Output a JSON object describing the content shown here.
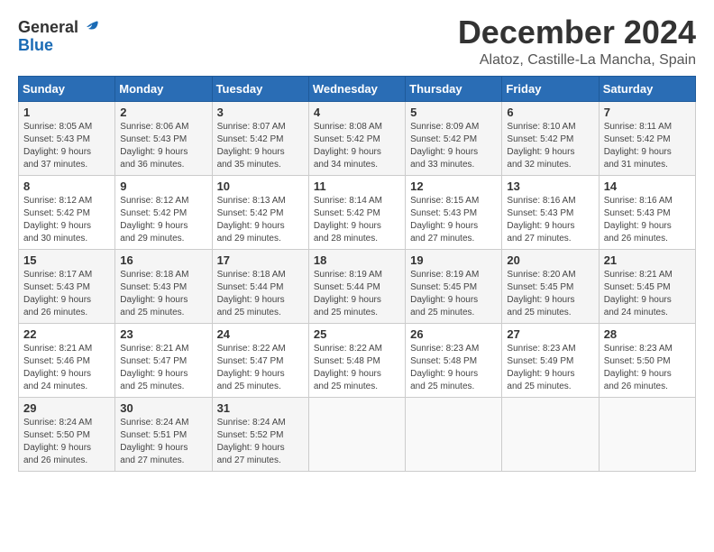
{
  "header": {
    "logo_line1": "General",
    "logo_line2": "Blue",
    "title": "December 2024",
    "location": "Alatoz, Castille-La Mancha, Spain"
  },
  "calendar": {
    "headers": [
      "Sunday",
      "Monday",
      "Tuesday",
      "Wednesday",
      "Thursday",
      "Friday",
      "Saturday"
    ],
    "weeks": [
      [
        {
          "day": "1",
          "detail": "Sunrise: 8:05 AM\nSunset: 5:43 PM\nDaylight: 9 hours\nand 37 minutes."
        },
        {
          "day": "2",
          "detail": "Sunrise: 8:06 AM\nSunset: 5:43 PM\nDaylight: 9 hours\nand 36 minutes."
        },
        {
          "day": "3",
          "detail": "Sunrise: 8:07 AM\nSunset: 5:42 PM\nDaylight: 9 hours\nand 35 minutes."
        },
        {
          "day": "4",
          "detail": "Sunrise: 8:08 AM\nSunset: 5:42 PM\nDaylight: 9 hours\nand 34 minutes."
        },
        {
          "day": "5",
          "detail": "Sunrise: 8:09 AM\nSunset: 5:42 PM\nDaylight: 9 hours\nand 33 minutes."
        },
        {
          "day": "6",
          "detail": "Sunrise: 8:10 AM\nSunset: 5:42 PM\nDaylight: 9 hours\nand 32 minutes."
        },
        {
          "day": "7",
          "detail": "Sunrise: 8:11 AM\nSunset: 5:42 PM\nDaylight: 9 hours\nand 31 minutes."
        }
      ],
      [
        {
          "day": "8",
          "detail": "Sunrise: 8:12 AM\nSunset: 5:42 PM\nDaylight: 9 hours\nand 30 minutes."
        },
        {
          "day": "9",
          "detail": "Sunrise: 8:12 AM\nSunset: 5:42 PM\nDaylight: 9 hours\nand 29 minutes."
        },
        {
          "day": "10",
          "detail": "Sunrise: 8:13 AM\nSunset: 5:42 PM\nDaylight: 9 hours\nand 29 minutes."
        },
        {
          "day": "11",
          "detail": "Sunrise: 8:14 AM\nSunset: 5:42 PM\nDaylight: 9 hours\nand 28 minutes."
        },
        {
          "day": "12",
          "detail": "Sunrise: 8:15 AM\nSunset: 5:43 PM\nDaylight: 9 hours\nand 27 minutes."
        },
        {
          "day": "13",
          "detail": "Sunrise: 8:16 AM\nSunset: 5:43 PM\nDaylight: 9 hours\nand 27 minutes."
        },
        {
          "day": "14",
          "detail": "Sunrise: 8:16 AM\nSunset: 5:43 PM\nDaylight: 9 hours\nand 26 minutes."
        }
      ],
      [
        {
          "day": "15",
          "detail": "Sunrise: 8:17 AM\nSunset: 5:43 PM\nDaylight: 9 hours\nand 26 minutes."
        },
        {
          "day": "16",
          "detail": "Sunrise: 8:18 AM\nSunset: 5:43 PM\nDaylight: 9 hours\nand 25 minutes."
        },
        {
          "day": "17",
          "detail": "Sunrise: 8:18 AM\nSunset: 5:44 PM\nDaylight: 9 hours\nand 25 minutes."
        },
        {
          "day": "18",
          "detail": "Sunrise: 8:19 AM\nSunset: 5:44 PM\nDaylight: 9 hours\nand 25 minutes."
        },
        {
          "day": "19",
          "detail": "Sunrise: 8:19 AM\nSunset: 5:45 PM\nDaylight: 9 hours\nand 25 minutes."
        },
        {
          "day": "20",
          "detail": "Sunrise: 8:20 AM\nSunset: 5:45 PM\nDaylight: 9 hours\nand 25 minutes."
        },
        {
          "day": "21",
          "detail": "Sunrise: 8:21 AM\nSunset: 5:45 PM\nDaylight: 9 hours\nand 24 minutes."
        }
      ],
      [
        {
          "day": "22",
          "detail": "Sunrise: 8:21 AM\nSunset: 5:46 PM\nDaylight: 9 hours\nand 24 minutes."
        },
        {
          "day": "23",
          "detail": "Sunrise: 8:21 AM\nSunset: 5:47 PM\nDaylight: 9 hours\nand 25 minutes."
        },
        {
          "day": "24",
          "detail": "Sunrise: 8:22 AM\nSunset: 5:47 PM\nDaylight: 9 hours\nand 25 minutes."
        },
        {
          "day": "25",
          "detail": "Sunrise: 8:22 AM\nSunset: 5:48 PM\nDaylight: 9 hours\nand 25 minutes."
        },
        {
          "day": "26",
          "detail": "Sunrise: 8:23 AM\nSunset: 5:48 PM\nDaylight: 9 hours\nand 25 minutes."
        },
        {
          "day": "27",
          "detail": "Sunrise: 8:23 AM\nSunset: 5:49 PM\nDaylight: 9 hours\nand 25 minutes."
        },
        {
          "day": "28",
          "detail": "Sunrise: 8:23 AM\nSunset: 5:50 PM\nDaylight: 9 hours\nand 26 minutes."
        }
      ],
      [
        {
          "day": "29",
          "detail": "Sunrise: 8:24 AM\nSunset: 5:50 PM\nDaylight: 9 hours\nand 26 minutes."
        },
        {
          "day": "30",
          "detail": "Sunrise: 8:24 AM\nSunset: 5:51 PM\nDaylight: 9 hours\nand 27 minutes."
        },
        {
          "day": "31",
          "detail": "Sunrise: 8:24 AM\nSunset: 5:52 PM\nDaylight: 9 hours\nand 27 minutes."
        },
        {
          "day": "",
          "detail": ""
        },
        {
          "day": "",
          "detail": ""
        },
        {
          "day": "",
          "detail": ""
        },
        {
          "day": "",
          "detail": ""
        }
      ]
    ]
  }
}
